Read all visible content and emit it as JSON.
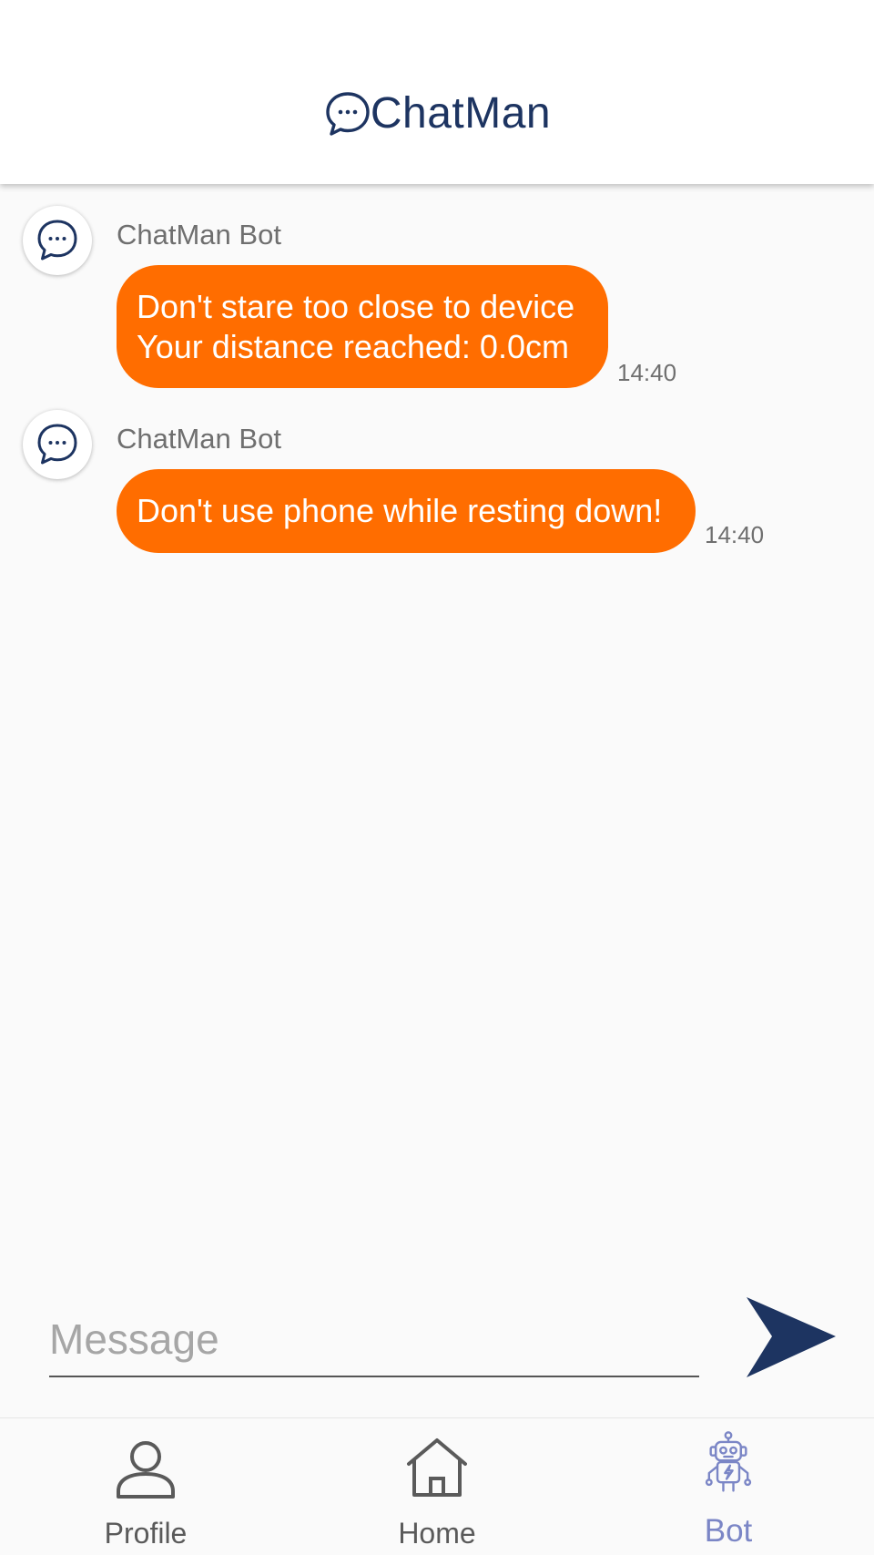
{
  "header": {
    "app_name": "ChatMan",
    "logo_icon": "chat-bubble-icon",
    "brand_color": "#1d3461"
  },
  "messages": [
    {
      "sender": "ChatMan Bot",
      "lines": [
        "Don't stare too close to device",
        "Your distance reached: 0.0cm"
      ],
      "time": "14:40",
      "avatar_icon": "chat-bubble-icon"
    },
    {
      "sender": "ChatMan Bot",
      "lines": [
        "Don't use phone while resting down!"
      ],
      "time": "14:40",
      "avatar_icon": "chat-bubble-icon"
    }
  ],
  "composer": {
    "placeholder": "Message",
    "value": "",
    "send_icon": "send-arrow-icon"
  },
  "bottom_nav": {
    "items": [
      {
        "label": "Profile",
        "icon": "person-icon",
        "active": false
      },
      {
        "label": "Home",
        "icon": "home-icon",
        "active": false
      },
      {
        "label": "Bot",
        "icon": "robot-icon",
        "active": true
      }
    ]
  },
  "colors": {
    "bubble": "#ff6d00",
    "bubble_text": "#ffffff",
    "accent_dark": "#1d3461",
    "active_nav": "#7b86c6",
    "background": "#fafafa"
  }
}
